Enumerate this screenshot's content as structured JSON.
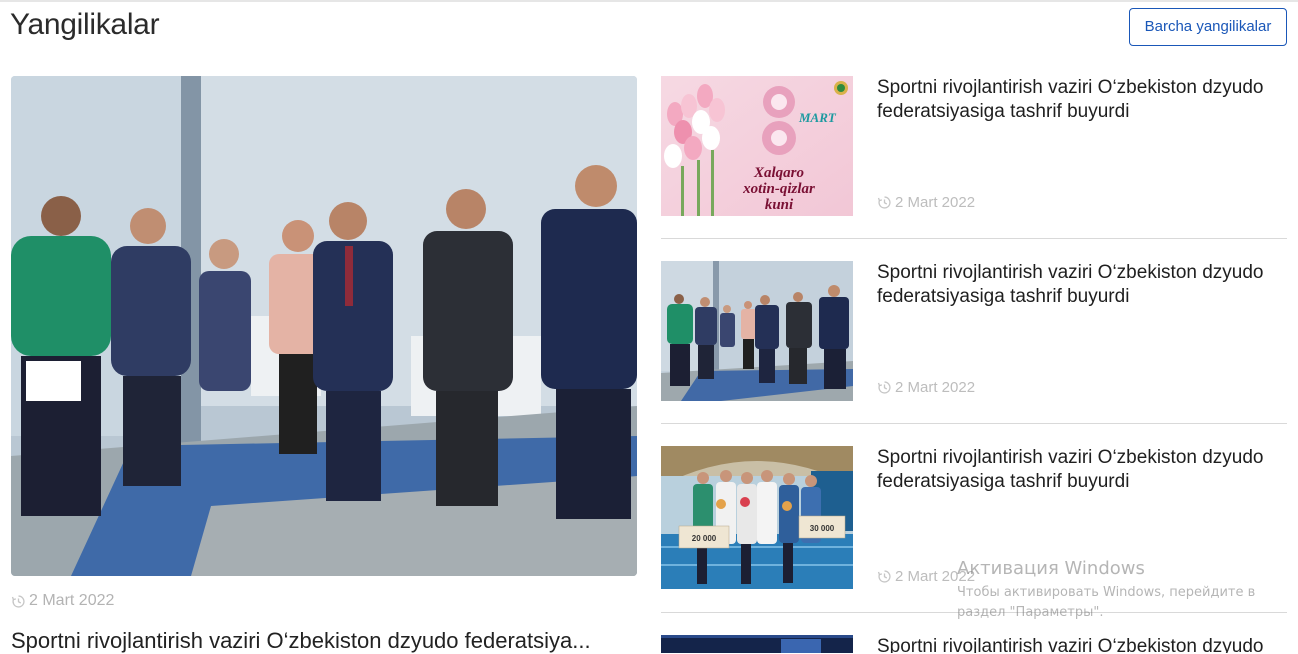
{
  "header": {
    "title": "Yangilikalar",
    "all_news_button": "Barcha yangilikalar"
  },
  "featured": {
    "date": "2 Mart 2022",
    "title": "Sportni rivojlantirish vaziri O‘zbekiston dzyudo federatsiya..."
  },
  "news": [
    {
      "title": "Sportni rivojlantirish vaziri O‘zbekiston dzyudo federatsiyasiga tashrif buyurdi",
      "date": "2 Mart 2022",
      "thumb_text": {
        "number": "8",
        "mart": "MART",
        "line1": "Xalqaro",
        "line2": "xotin-qizlar",
        "line3": "kuni"
      }
    },
    {
      "title": "Sportni rivojlantirish vaziri O‘zbekiston dzyudo federatsiyasiga tashrif buyurdi",
      "date": "2 Mart 2022"
    },
    {
      "title": "Sportni rivojlantirish vaziri O‘zbekiston dzyudo federatsiyasiga tashrif buyurdi",
      "date": "2 Mart 2022",
      "thumb_text": {
        "cheque_a": "20 000",
        "cheque_b": "30 000"
      }
    },
    {
      "title": "Sportni rivojlantirish vaziri O‘zbekiston dzyudo"
    }
  ],
  "watermark": {
    "title": "Активация Windows",
    "subtitle": "Чтобы активировать Windows, перейдите в раздел \"Параметры\"."
  },
  "colors": {
    "accent": "#1a57b8",
    "date_gray": "#b3b3b3",
    "divider": "#d9d9d9"
  },
  "icons": {
    "date": "clock-history-icon"
  }
}
